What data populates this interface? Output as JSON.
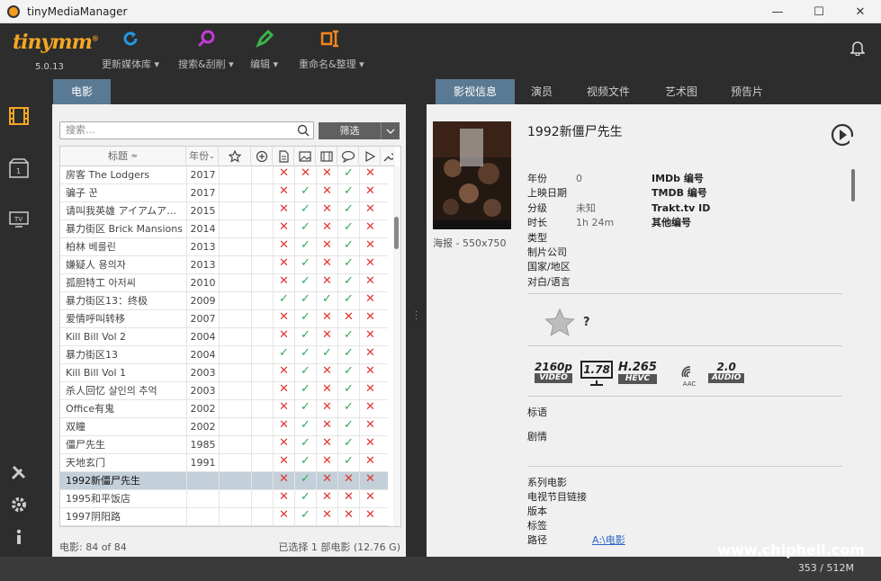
{
  "window": {
    "title": "tinyMediaManager",
    "minimize": "—",
    "maximize": "☐",
    "close": "✕"
  },
  "app": {
    "logo": "tinymm",
    "logo_mark": "®",
    "version": "5.0.13"
  },
  "toolbar": {
    "update": "更新媒体库",
    "search": "搜索&刮削",
    "edit": "编辑",
    "rename": "重命名&整理"
  },
  "left_tabs": {
    "movies": "电影"
  },
  "search": {
    "placeholder": "搜索..."
  },
  "filter": {
    "label": "筛选"
  },
  "table": {
    "headers": {
      "title": "标题",
      "year": "年份"
    },
    "rows": [
      {
        "title": "房客 The Lodgers",
        "year": "2017",
        "marks": [
          "x",
          "x",
          "x",
          "v",
          "x"
        ]
      },
      {
        "title": "骗子 꾼",
        "year": "2017",
        "marks": [
          "x",
          "v",
          "x",
          "v",
          "x"
        ]
      },
      {
        "title": "请叫我英雄 アイアムア…",
        "year": "2015",
        "marks": [
          "x",
          "v",
          "x",
          "v",
          "x"
        ]
      },
      {
        "title": "暴力街区 Brick Mansions",
        "year": "2014",
        "marks": [
          "x",
          "v",
          "x",
          "v",
          "x"
        ]
      },
      {
        "title": "柏林 베를린",
        "year": "2013",
        "marks": [
          "x",
          "v",
          "x",
          "v",
          "x"
        ]
      },
      {
        "title": "嫌疑人 용의자",
        "year": "2013",
        "marks": [
          "x",
          "v",
          "x",
          "v",
          "x"
        ]
      },
      {
        "title": "孤胆特工 아저씨",
        "year": "2010",
        "marks": [
          "x",
          "v",
          "x",
          "v",
          "x"
        ]
      },
      {
        "title": "暴力街区13：终极",
        "year": "2009",
        "marks": [
          "v",
          "v",
          "v",
          "v",
          "x"
        ]
      },
      {
        "title": "爱情呼叫转移",
        "year": "2007",
        "marks": [
          "x",
          "v",
          "x",
          "x",
          "x"
        ]
      },
      {
        "title": "Kill Bill Vol 2",
        "year": "2004",
        "marks": [
          "x",
          "v",
          "x",
          "v",
          "x"
        ]
      },
      {
        "title": "暴力街区13",
        "year": "2004",
        "marks": [
          "v",
          "v",
          "v",
          "v",
          "x"
        ]
      },
      {
        "title": "Kill Bill Vol 1",
        "year": "2003",
        "marks": [
          "x",
          "v",
          "x",
          "v",
          "x"
        ]
      },
      {
        "title": "杀人回忆 살인의 추억",
        "year": "2003",
        "marks": [
          "x",
          "v",
          "x",
          "v",
          "x"
        ]
      },
      {
        "title": "Office有鬼",
        "year": "2002",
        "marks": [
          "x",
          "v",
          "x",
          "v",
          "x"
        ]
      },
      {
        "title": "双瞳",
        "year": "2002",
        "marks": [
          "x",
          "v",
          "x",
          "v",
          "x"
        ]
      },
      {
        "title": "僵尸先生",
        "year": "1985",
        "marks": [
          "x",
          "v",
          "x",
          "v",
          "x"
        ]
      },
      {
        "title": "天地玄门",
        "year": "1991",
        "marks": [
          "x",
          "v",
          "x",
          "v",
          "x"
        ]
      },
      {
        "title": "1992新僵尸先生",
        "year": "",
        "marks": [
          "x",
          "v",
          "x",
          "x",
          "x"
        ],
        "selected": true
      },
      {
        "title": "1995和平饭店",
        "year": "",
        "marks": [
          "x",
          "v",
          "x",
          "x",
          "x"
        ]
      },
      {
        "title": "1997阴阳路",
        "year": "",
        "marks": [
          "x",
          "v",
          "x",
          "x",
          "x"
        ]
      }
    ]
  },
  "status": {
    "count": "电影:  84  of  84",
    "selected": "已选择 1 部电影 (12.76 G)"
  },
  "right_tabs": [
    "影视信息",
    "演员",
    "视频文件",
    "艺术图",
    "预告片"
  ],
  "movie": {
    "title": "1992新僵尸先生",
    "poster_caption": "海报 - 550x750",
    "fields": [
      {
        "label": "年份",
        "value": "0"
      },
      {
        "label": "上映日期",
        "value": ""
      },
      {
        "label": "分级",
        "value": "未知"
      },
      {
        "label": "时长",
        "value": "1h 24m"
      },
      {
        "label": "类型",
        "value": ""
      },
      {
        "label": "制片公司",
        "value": ""
      },
      {
        "label": "国家/地区",
        "value": ""
      },
      {
        "label": "对白/语言",
        "value": ""
      }
    ],
    "ids": [
      "IMDb 编号",
      "TMDB 编号",
      "Trakt.tv ID",
      "其他编号"
    ],
    "rating": "?",
    "media": {
      "res": "2160p",
      "res_sub": "VIDEO",
      "aspect": "1.78",
      "codec": "H.265",
      "codec_sub": "HEVC",
      "aac": "AAC",
      "channels": "2.0",
      "audio_sub": "AUDIO"
    },
    "tagline_label": "标语",
    "plot_label": "剧情",
    "extra_labels": [
      "系列电影",
      "电视节目链接",
      "版本",
      "标签",
      "路径"
    ],
    "path_value": "A:\\电影"
  },
  "memory": "353 / 512M",
  "watermark": "www.chiphell.com"
}
